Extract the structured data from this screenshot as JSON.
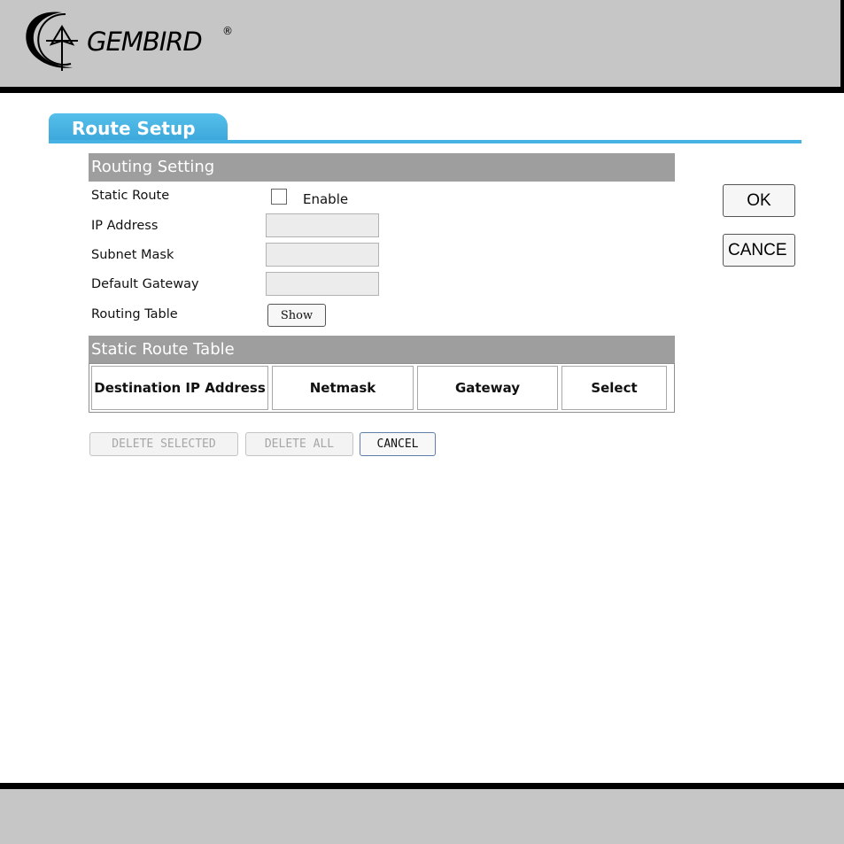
{
  "brand": {
    "name": "GEMBIRD",
    "registered": "®"
  },
  "page": {
    "tab_title": "Route Setup"
  },
  "routing_setting": {
    "section_title": "Routing Setting",
    "static_route_label": "Static Route",
    "enable_label": "Enable",
    "ip_address_label": "IP Address",
    "subnet_mask_label": "Subnet Mask",
    "default_gateway_label": "Default Gateway",
    "routing_table_label": "Routing Table",
    "show_button": "Show"
  },
  "static_route_table": {
    "section_title": "Static Route Table",
    "columns": [
      "Destination IP Address",
      "Netmask",
      "Gateway",
      "Select"
    ]
  },
  "actions": {
    "delete_selected": "DELETE SELECTED",
    "delete_all": "DELETE ALL",
    "cancel": "CANCEL"
  },
  "side_actions": {
    "ok": "OK",
    "cancel": "CANCE"
  },
  "colors": {
    "tab_blue": "#3aa6da",
    "section_gray": "#9e9e9e",
    "header_gray": "#c6c6c6"
  }
}
